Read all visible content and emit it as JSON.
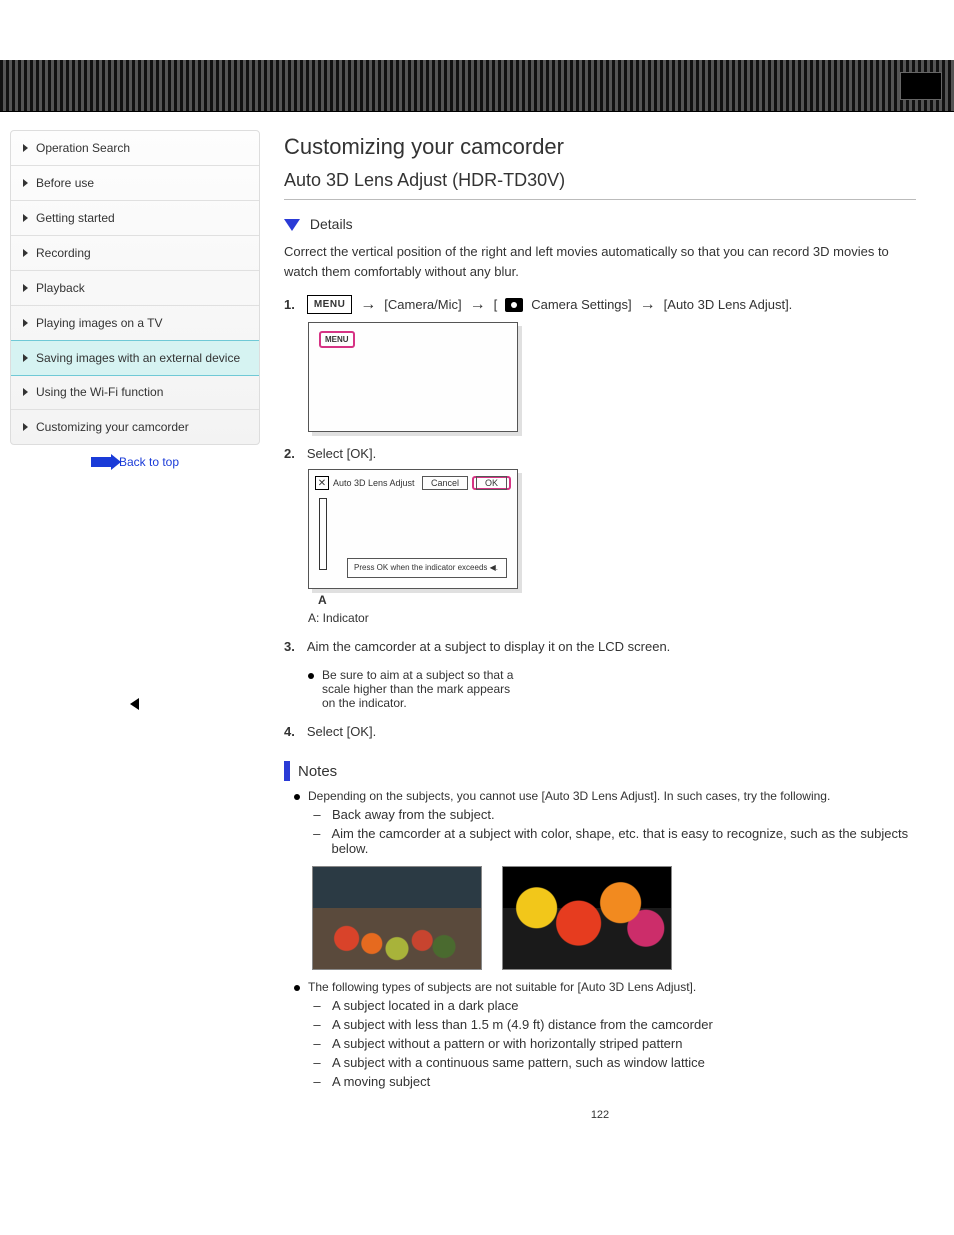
{
  "nav": {
    "items": [
      {
        "label": "Operation Search"
      },
      {
        "label": "Before use"
      },
      {
        "label": "Getting started"
      },
      {
        "label": "Recording"
      },
      {
        "label": "Playback"
      },
      {
        "label": "Playing images on a TV"
      },
      {
        "label": "Saving images with an external device"
      },
      {
        "label": "Using the Wi-Fi function"
      },
      {
        "label": "Customizing your camcorder"
      }
    ],
    "activeIndex": 6
  },
  "back_label": "Back to top",
  "title": "Customizing your camcorder",
  "subtitle": "Auto 3D Lens Adjust (HDR-TD30V)",
  "details_label": "Details",
  "intro1": "Correct the vertical position of the right and left movies automatically so that you can record 3D movies to watch them comfortably without any blur.",
  "step1": {
    "num": "1.",
    "seg1": "[Camera/Mic]",
    "seg2": "[",
    "seg3": "Camera Settings]",
    "seg4": "[Auto 3D Lens Adjust]."
  },
  "step2_num": "2.",
  "step2_text": "Select [OK].",
  "screenshot2": {
    "close": "✕",
    "title": "Auto 3D Lens Adjust",
    "cancel": "Cancel",
    "ok": "OK",
    "msg": "Press OK when the indicator exceeds ◀."
  },
  "labelA": "A",
  "legendA": "A: Indicator",
  "step3_num": "3.",
  "step3_text": "Aim the camcorder at a subject to display it on the LCD screen.",
  "note3": "Be sure to aim at a subject so that a scale higher than the    mark appears on the indicator.",
  "step4_num": "4.",
  "step4_text": "Select [OK].",
  "notes_heading": "Notes",
  "note_intro1": "Depending on the subjects, you cannot use [Auto 3D Lens Adjust]. In such cases, try the following.",
  "dash1": [
    "Back away from the subject.",
    "Aim the camcorder at a subject with color, shape, etc. that is easy to recognize, such as the subjects below."
  ],
  "note_intro2": "The following types of subjects are not suitable for [Auto 3D Lens Adjust].",
  "dash2": [
    "A subject located in a dark place",
    "A subject with less than 1.5 m (4.9 ft) distance from the camcorder",
    "A subject without a pattern or with horizontally striped pattern",
    "A subject with a continuous same pattern, such as window lattice",
    "A moving subject"
  ],
  "page_number": "122"
}
